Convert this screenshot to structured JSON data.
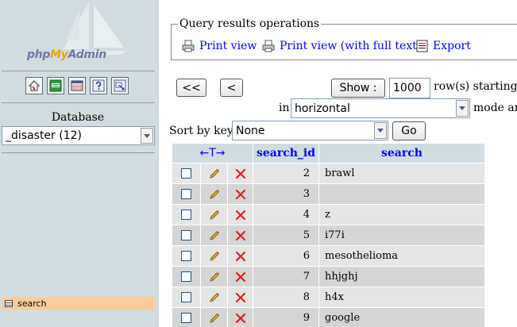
{
  "app": {
    "logo_parts": [
      "php",
      "My",
      "Admin"
    ]
  },
  "nav": {
    "icons": [
      {
        "name": "home-icon"
      },
      {
        "name": "exit-icon"
      },
      {
        "name": "sql-query-icon"
      },
      {
        "name": "help-icon"
      },
      {
        "name": "docs-icon"
      }
    ],
    "database_label": "Database",
    "database_select": "_disaster (12)",
    "table_link": "search"
  },
  "operations": {
    "legend": "Query results operations",
    "print_view": "Print view",
    "print_view_full": "Print view (with full texts)",
    "export": "Export"
  },
  "navigation": {
    "first_button": "<<",
    "prev_button": "<",
    "show_button": "Show :",
    "rows_value": "1000",
    "rows_suffix": "row(s) starting fro",
    "in_label": "in",
    "mode_select": "horizontal",
    "mode_suffix": "mode and"
  },
  "sort": {
    "label": "Sort by key:",
    "select": "None",
    "go_button": "Go"
  },
  "table": {
    "sort_header": "←T→",
    "columns": [
      "search_id",
      "search"
    ],
    "rows": [
      {
        "search_id": "2",
        "search": "brawl"
      },
      {
        "search_id": "3",
        "search": ""
      },
      {
        "search_id": "4",
        "search": "z"
      },
      {
        "search_id": "5",
        "search": "i77i"
      },
      {
        "search_id": "6",
        "search": "mesothelioma"
      },
      {
        "search_id": "7",
        "search": "hhjghj"
      },
      {
        "search_id": "8",
        "search": "h4x"
      },
      {
        "search_id": "9",
        "search": "google"
      }
    ]
  },
  "colors": {
    "nav_bg": "#d0dce0",
    "link": "#0000ff",
    "row_odd": "#e5e5e5",
    "row_even": "#d5d5d5",
    "table_link_bg": "#ffcc99",
    "delete_red": "#e0201c"
  }
}
